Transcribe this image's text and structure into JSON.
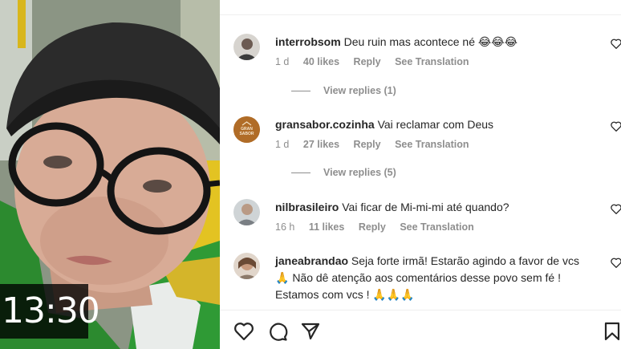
{
  "video": {
    "timestamp": "13:30"
  },
  "comments": [
    {
      "username": "interrobsom",
      "text": "Deu ruin mas acontece né 😂😂😂",
      "age": "1 d",
      "likes": "40 likes",
      "reply_label": "Reply",
      "translate_label": "See Translation",
      "view_replies": "View replies (1)"
    },
    {
      "username": "gransabor.cozinha",
      "text": "Vai reclamar com Deus",
      "age": "1 d",
      "likes": "27 likes",
      "reply_label": "Reply",
      "translate_label": "See Translation",
      "view_replies": "View replies (5)",
      "avatar_text": "GRAN SABOR"
    },
    {
      "username": "nilbrasileiro",
      "text": "Vai ficar de Mi-mi-mi até quando?",
      "age": "16 h",
      "likes": "11 likes",
      "reply_label": "Reply",
      "translate_label": "See Translation"
    },
    {
      "username": "janeabrandao",
      "text": "Seja forte irmã! Estarão agindo a favor de vcs 🙏 Não dê atenção aos comentários desse povo sem fé ! Estamos com vcs ! 🙏🙏🙏"
    }
  ],
  "actions": {
    "icons": [
      "heart-icon",
      "comment-icon",
      "share-icon",
      "bookmark-icon"
    ]
  },
  "colors": {
    "text": "#262626",
    "muted": "#8e8e8e",
    "divider": "#efefef"
  }
}
